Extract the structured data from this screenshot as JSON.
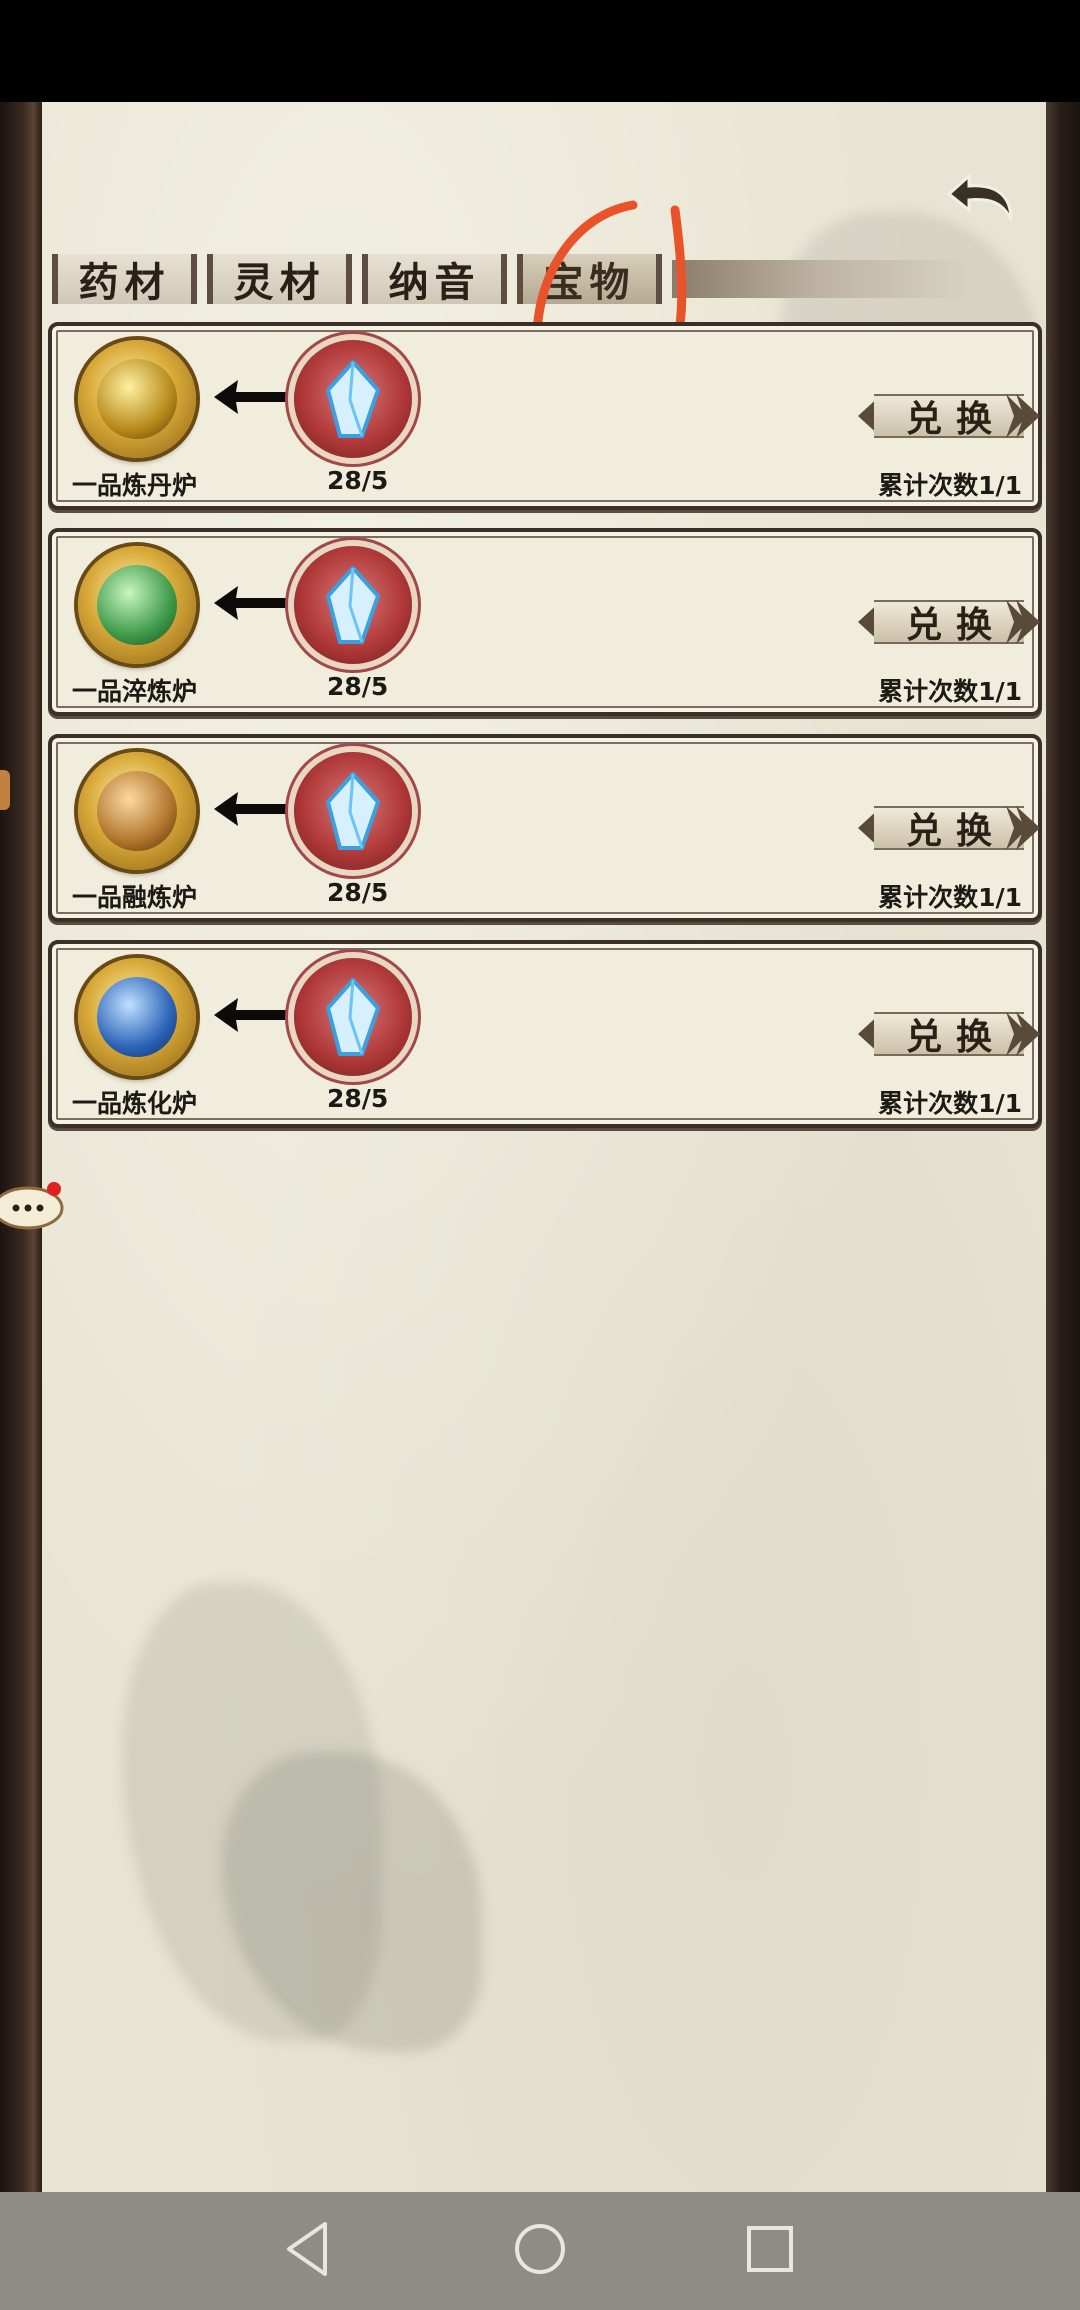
{
  "tabs": [
    {
      "label": "药材",
      "active": false
    },
    {
      "label": "灵材",
      "active": false
    },
    {
      "label": "纳音",
      "active": false
    },
    {
      "label": "宝物",
      "active": true
    }
  ],
  "items": [
    {
      "name": "一品炼丹炉",
      "count": "28/5",
      "exchange_label": [
        "兑",
        "换"
      ],
      "exchange_count": "累计次数1/1",
      "icon": "gold-furnace-icon",
      "color": "#c9a23a"
    },
    {
      "name": "一品淬炼炉",
      "count": "28/5",
      "exchange_label": [
        "兑",
        "换"
      ],
      "exchange_count": "累计次数1/1",
      "icon": "green-furnace-icon",
      "color": "#3f9a4a"
    },
    {
      "name": "一品融炼炉",
      "count": "28/5",
      "exchange_label": [
        "兑",
        "换"
      ],
      "exchange_count": "累计次数1/1",
      "icon": "bronze-furnace-icon",
      "color": "#b0752c"
    },
    {
      "name": "一品炼化炉",
      "count": "28/5",
      "exchange_label": [
        "兑",
        "换"
      ],
      "exchange_count": "累计次数1/1",
      "icon": "blue-furnace-icon",
      "color": "#2c64b8"
    }
  ],
  "cost_icon": "spirit-crystal-icon",
  "colors": {
    "annotation": "#e8532a",
    "paper": "#e8e4d3",
    "card": "#f1eddd"
  },
  "nav": [
    "back-nav-icon",
    "home-nav-icon",
    "recents-nav-icon"
  ]
}
